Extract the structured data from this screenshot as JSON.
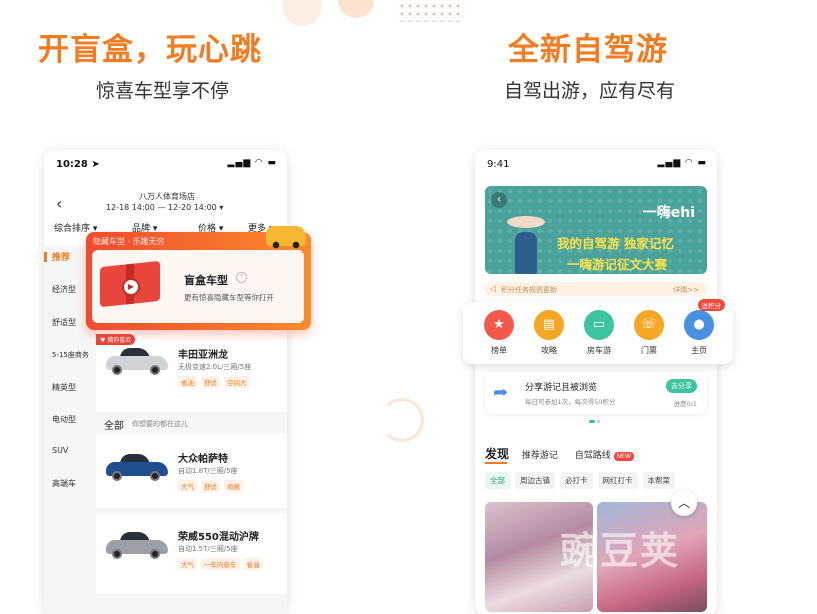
{
  "left": {
    "headline": "开盲盒，玩心跳",
    "subline": "惊喜车型享不停",
    "status_time": "10:28 ➤",
    "store": "八万人体育场店",
    "dates": "12-18  14:00  —  12-20  14:00 ▾",
    "filters": [
      "综合排序 ▾",
      "品牌 ▾",
      "价格 ▾",
      "更多 ▾"
    ],
    "sidebar": [
      "推荐",
      "经济型",
      "舒适型",
      "5-15座商务",
      "精英型",
      "电动型",
      "SUV",
      "高端车"
    ],
    "blind_box": {
      "title": "隐藏车型 · 乐趣无穷",
      "name": "盲盒车型",
      "help": "?",
      "desc": "更有惊喜隐藏车型等你打开",
      "play": "▶"
    },
    "badge": "♥ 猜你喜欢",
    "cars": [
      {
        "name": "丰田亚洲龙",
        "spec": "无极变速2.0L/三厢/5座",
        "tags": [
          "省油",
          "舒适",
          "空间大"
        ],
        "color": "#cfd3d8"
      },
      {
        "name": "大众帕萨特",
        "spec": "自动1.8T/三厢/5座",
        "tags": [
          "大气",
          "舒适",
          "商務"
        ],
        "color": "#1f4f8f"
      },
      {
        "name": "荣威550混动沪牌",
        "spec": "自动1.5T/三厢/5座",
        "tags": [
          "大气",
          "一年内新车",
          "省油"
        ],
        "color": "#9aa0a6"
      }
    ],
    "section": {
      "title": "全部",
      "sub": "你想要的都在这儿"
    }
  },
  "right": {
    "headline": "全新自驾游",
    "subline": "自驾出游，应有尽有",
    "status_time": "9:41",
    "banner": {
      "logo": "一嗨ehi",
      "line1": "我的自驾游 独家记忆",
      "line2": "一嗨游记征文大赛",
      "back": "‹"
    },
    "notice": {
      "text": "积分任务规则更新",
      "link": "详情>>"
    },
    "shortcuts": [
      {
        "label": "榜单",
        "icon": "★",
        "color": "#f2594b"
      },
      {
        "label": "攻略",
        "icon": "▤",
        "color": "#f5a623"
      },
      {
        "label": "房车游",
        "icon": "▭",
        "color": "#3cc4a0"
      },
      {
        "label": "门票",
        "icon": "☏",
        "color": "#f5a623"
      },
      {
        "label": "主页",
        "icon": "●",
        "color": "#4a90e2"
      }
    ],
    "shortcut_badge": "送积分",
    "share": {
      "title": "分享游记且被浏览",
      "sub": "每日可参加1次，每次得50积分",
      "button": "去分享",
      "progress": "进度0/1"
    },
    "tabs": {
      "main": "发现",
      "t2": "推荐游记",
      "t3": "自驾路线",
      "new": "NEW"
    },
    "chips": [
      "全部",
      "周边古镇",
      "必打卡",
      "网红打卡",
      "本帮菜"
    ],
    "up": "︿"
  },
  "watermark": "豌豆荚"
}
